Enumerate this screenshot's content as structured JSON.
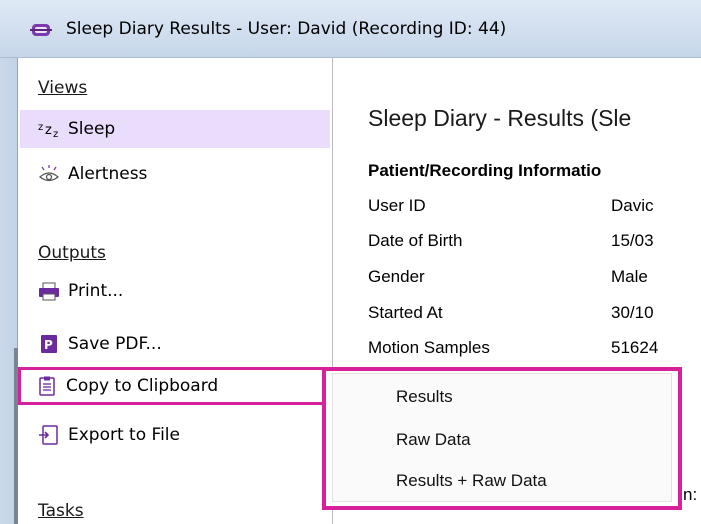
{
  "window": {
    "title": "Sleep Diary Results - User: David (Recording ID: 44)",
    "app_icon": "app-logo-icon"
  },
  "sidebar": {
    "views_title": "Views",
    "views": [
      {
        "label": "Sleep",
        "icon": "sleep-zzz-icon",
        "active": true
      },
      {
        "label": "Alertness",
        "icon": "alert-eye-icon",
        "active": false
      }
    ],
    "outputs_title": "Outputs",
    "outputs": [
      {
        "label": "Print...",
        "icon": "printer-icon"
      },
      {
        "label": "Save PDF...",
        "icon": "pdf-icon"
      },
      {
        "label": "Copy to Clipboard",
        "icon": "clipboard-icon",
        "highlighted": true
      },
      {
        "label": "Export to File",
        "icon": "export-file-icon"
      }
    ],
    "tasks_title": "Tasks"
  },
  "main": {
    "title": "Sleep Diary - Results (Sle",
    "info_heading": "Patient/Recording Informatio",
    "rows": [
      {
        "label": "User ID",
        "value": "Davic"
      },
      {
        "label": "Date of Birth",
        "value": "15/03"
      },
      {
        "label": "Gender",
        "value": "Male"
      },
      {
        "label": "Started At",
        "value": "30/10"
      },
      {
        "label": "Motion Samples",
        "value": "51624"
      }
    ],
    "partial_text": "n:"
  },
  "dropdown": {
    "items": [
      "Results",
      "Raw Data",
      "Results + Raw Data"
    ]
  },
  "colors": {
    "highlight": "#d6219b",
    "active_bg": "#eadcfb",
    "title_bar": "#c6d6ea"
  }
}
